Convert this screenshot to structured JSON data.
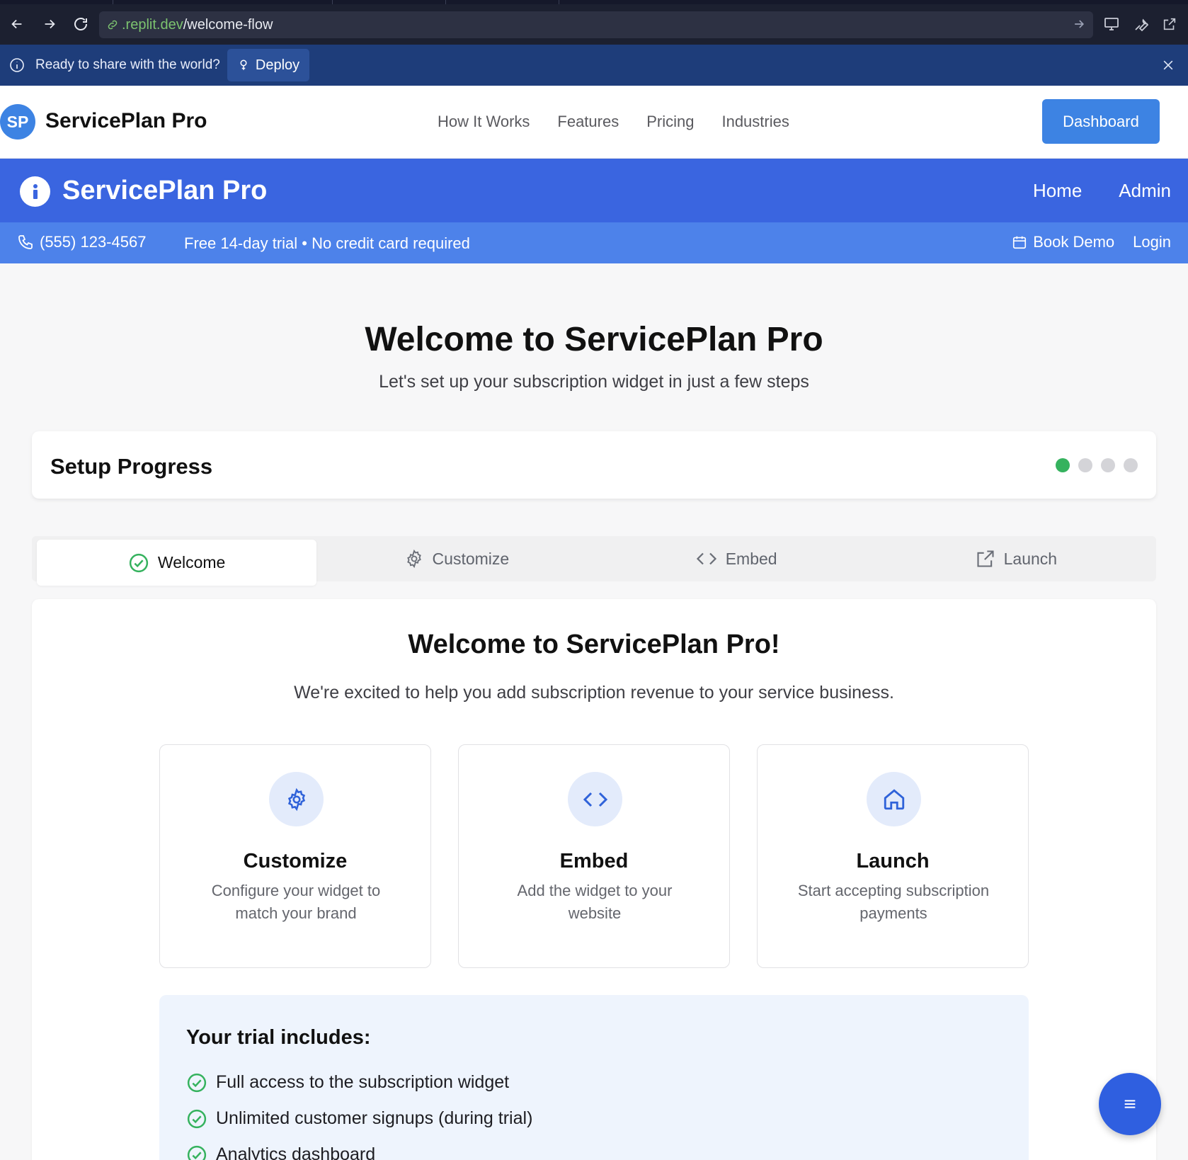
{
  "browser": {
    "url_domain": ".replit.dev",
    "url_path": "/welcome-flow"
  },
  "deploy_bar": {
    "message": "Ready to share with the world?",
    "deploy_label": "Deploy"
  },
  "site_header": {
    "logo_initials": "SP",
    "brand": "ServicePlan Pro",
    "nav": [
      "How It Works",
      "Features",
      "Pricing",
      "Industries"
    ],
    "dashboard_label": "Dashboard"
  },
  "app_bar": {
    "title": "ServicePlan Pro",
    "links": [
      "Home",
      "Admin"
    ]
  },
  "info_strip": {
    "phone": "(555) 123-4567",
    "trial": "Free 14-day trial • No credit card required",
    "book_demo": "Book Demo",
    "login": "Login"
  },
  "hero": {
    "title": "Welcome to ServicePlan Pro",
    "subtitle": "Let's set up your subscription widget in just a few steps"
  },
  "progress": {
    "label": "Setup Progress",
    "total_steps": 4,
    "completed_steps": 1
  },
  "tabs": [
    {
      "label": "Welcome",
      "icon": "check-circle-icon",
      "active": true
    },
    {
      "label": "Customize",
      "icon": "gear-icon",
      "active": false
    },
    {
      "label": "Embed",
      "icon": "code-icon",
      "active": false
    },
    {
      "label": "Launch",
      "icon": "external-link-icon",
      "active": false
    }
  ],
  "welcome": {
    "heading": "Welcome to ServicePlan Pro!",
    "lead": "We're excited to help you add subscription revenue to your service business.",
    "features": [
      {
        "title": "Customize",
        "desc": "Configure your widget to match your brand",
        "icon": "gear-icon"
      },
      {
        "title": "Embed",
        "desc": "Add the widget to your website",
        "icon": "code-icon"
      },
      {
        "title": "Launch",
        "desc": "Start accepting subscription payments",
        "icon": "home-icon"
      }
    ],
    "trial_heading": "Your trial includes:",
    "trial_items": [
      "Full access to the subscription widget",
      "Unlimited customer signups (during trial)",
      "Analytics dashboard"
    ]
  },
  "colors": {
    "primary": "#3a65e0",
    "accent": "#3d83e3",
    "success": "#35b25e",
    "deploy_bar": "#1e3d7a"
  }
}
